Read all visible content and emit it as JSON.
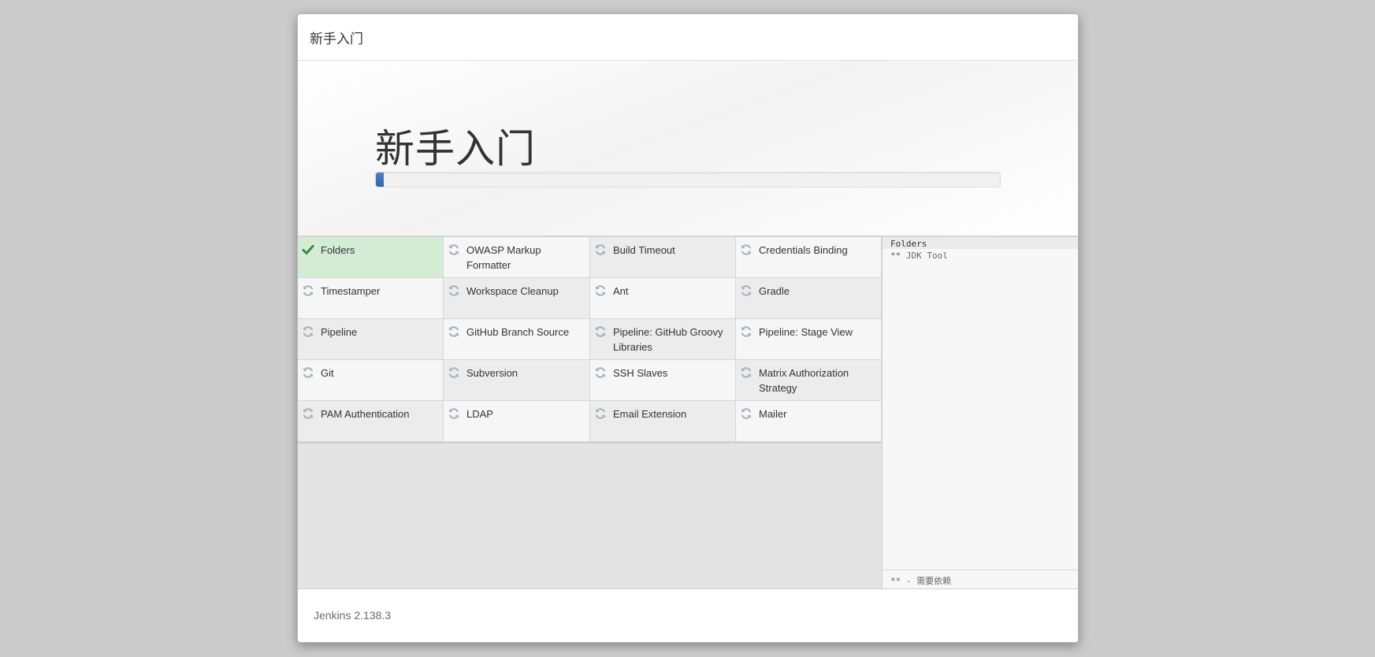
{
  "dialog": {
    "title": "新手入门"
  },
  "hero": {
    "title": "新手入门",
    "progress_fraction": 0.012
  },
  "plugins": [
    {
      "name": "Folders",
      "status": "installed",
      "icon": "check-icon"
    },
    {
      "name": "OWASP Markup Formatter",
      "status": "pending",
      "icon": "refresh-icon"
    },
    {
      "name": "Build Timeout",
      "status": "pending",
      "icon": "refresh-icon"
    },
    {
      "name": "Credentials Binding",
      "status": "pending",
      "icon": "refresh-icon"
    },
    {
      "name": "Timestamper",
      "status": "pending",
      "icon": "refresh-icon"
    },
    {
      "name": "Workspace Cleanup",
      "status": "pending",
      "icon": "refresh-icon"
    },
    {
      "name": "Ant",
      "status": "pending",
      "icon": "refresh-icon"
    },
    {
      "name": "Gradle",
      "status": "pending",
      "icon": "refresh-icon"
    },
    {
      "name": "Pipeline",
      "status": "installing",
      "icon": "spinner-icon"
    },
    {
      "name": "GitHub Branch Source",
      "status": "pending",
      "icon": "refresh-icon"
    },
    {
      "name": "Pipeline: GitHub Groovy Libraries",
      "status": "installing",
      "icon": "spinner-icon"
    },
    {
      "name": "Pipeline: Stage View",
      "status": "pending",
      "icon": "refresh-icon"
    },
    {
      "name": "Git",
      "status": "pending",
      "icon": "refresh-icon"
    },
    {
      "name": "Subversion",
      "status": "pending",
      "icon": "refresh-icon"
    },
    {
      "name": "SSH Slaves",
      "status": "pending",
      "icon": "refresh-icon"
    },
    {
      "name": "Matrix Authorization Strategy",
      "status": "pending",
      "icon": "refresh-icon"
    },
    {
      "name": "PAM Authentication",
      "status": "pending",
      "icon": "refresh-icon"
    },
    {
      "name": "LDAP",
      "status": "pending",
      "icon": "refresh-icon"
    },
    {
      "name": "Email Extension",
      "status": "pending",
      "icon": "refresh-icon"
    },
    {
      "name": "Mailer",
      "status": "pending",
      "icon": "refresh-icon"
    }
  ],
  "log": {
    "lines": [
      "Folders",
      "** JDK Tool"
    ],
    "footer": "** - 需要依赖"
  },
  "footer": {
    "version": "Jenkins 2.138.3"
  },
  "colors": {
    "installed_bg": "#d4ecd4",
    "check": "#3a8a3a",
    "progress": "#2d66ab",
    "pending_icon": "#a9b0b6"
  }
}
